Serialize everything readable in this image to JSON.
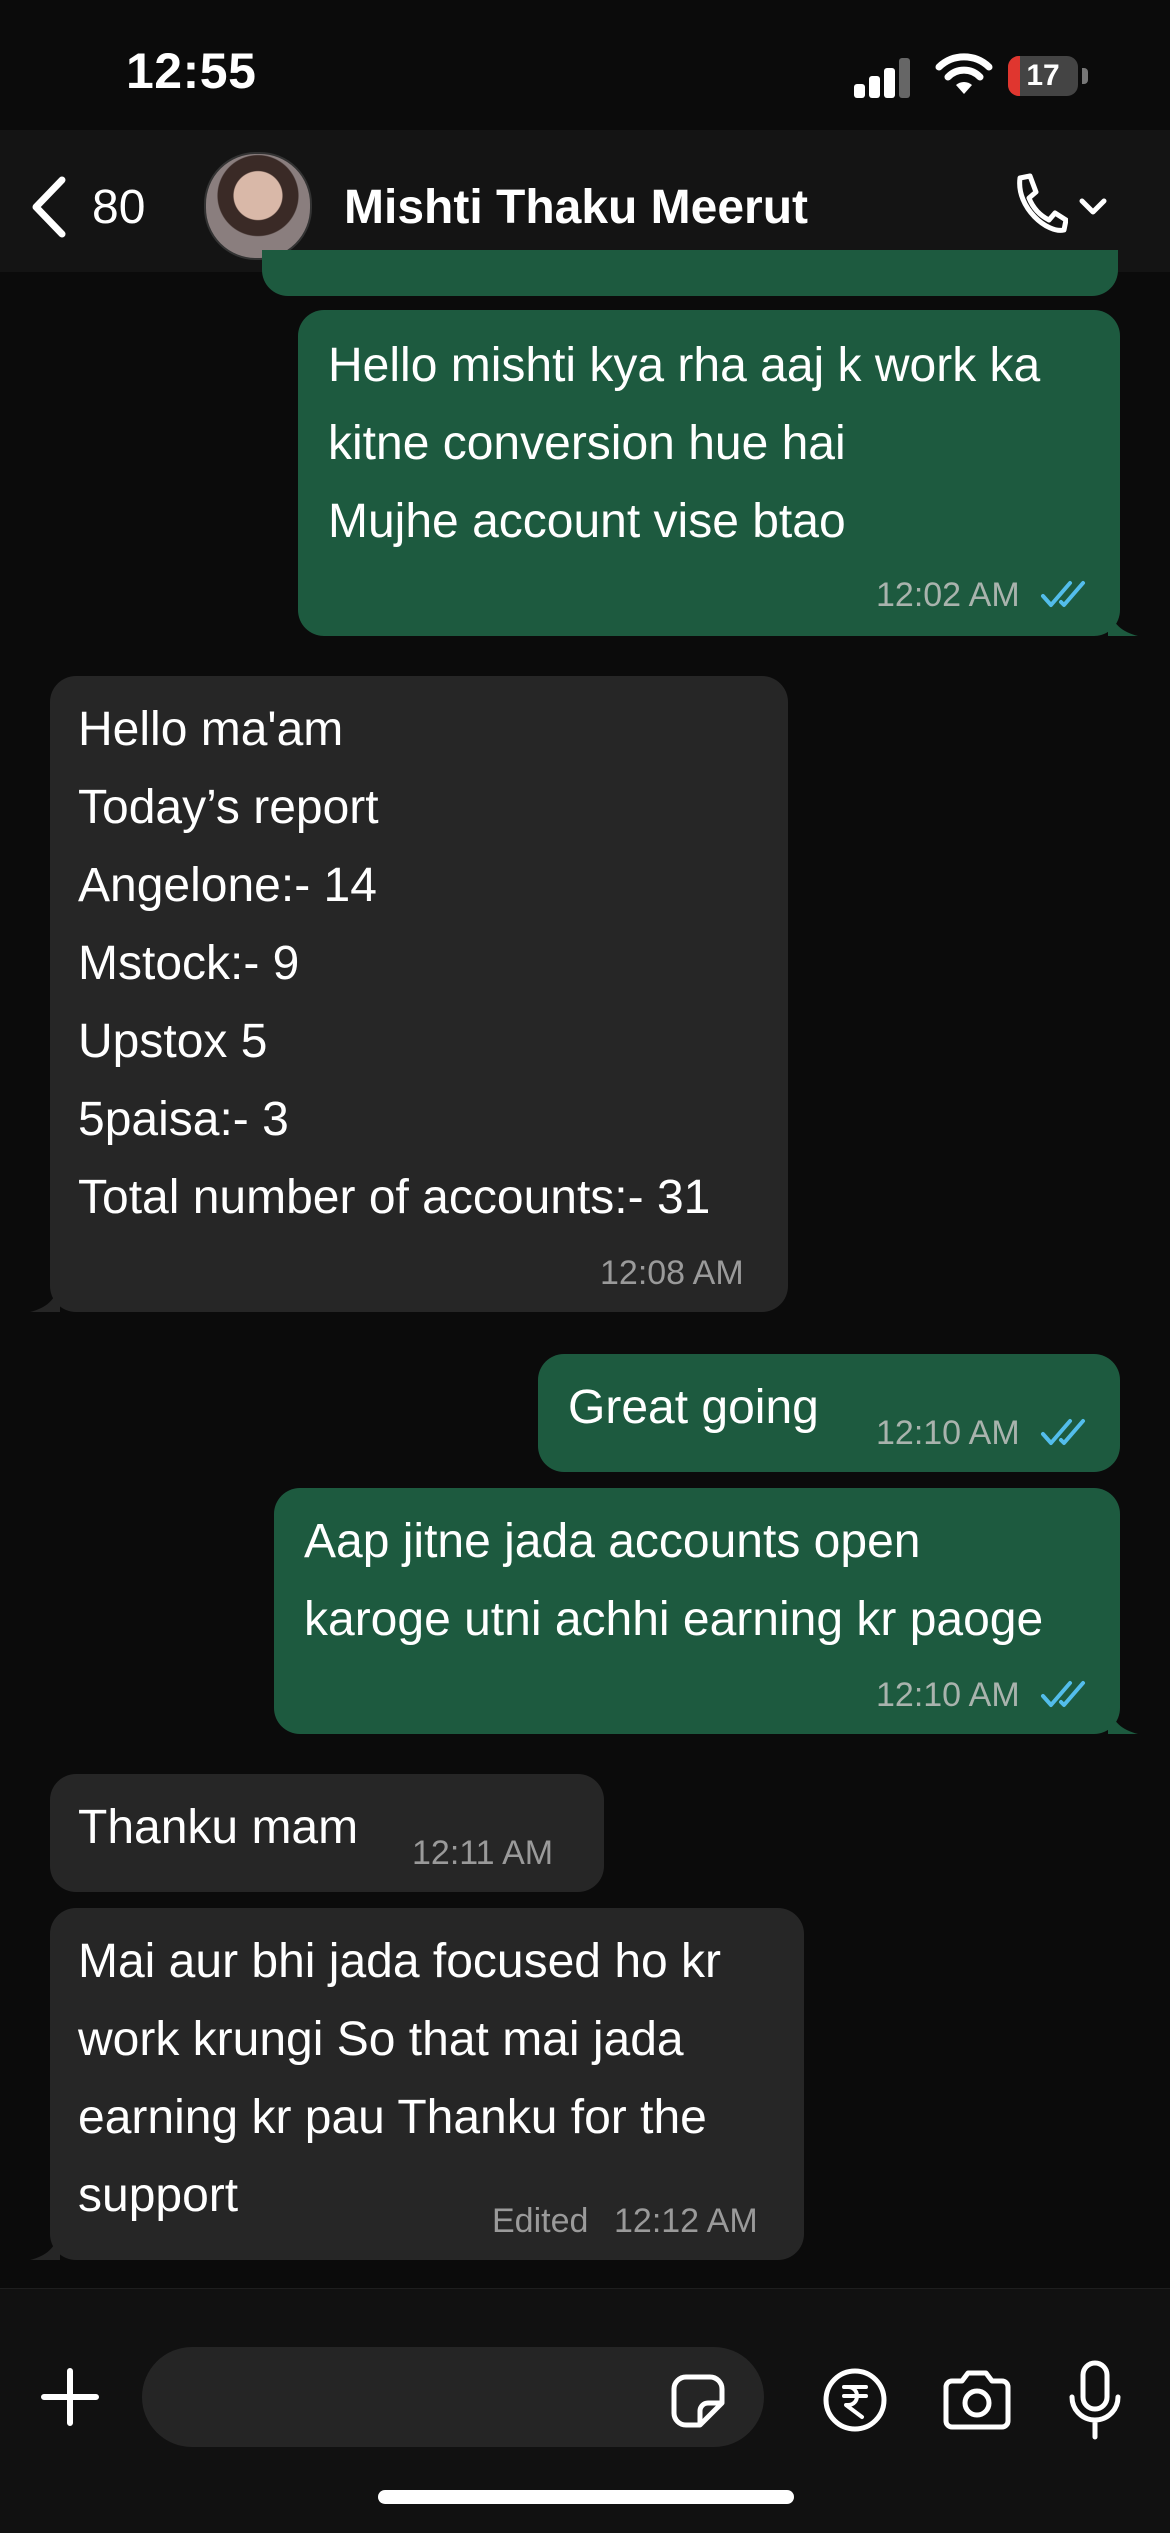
{
  "status_bar": {
    "time": "12:55",
    "battery": "17",
    "battery_level": 0.17
  },
  "header": {
    "back_count": "80",
    "contact_name": "Mishti Thaku Meerut"
  },
  "messages": [
    {
      "lines": [
        "Hello mishti kya rha aaj k work ka",
        "kitne conversion hue hai",
        "Mujhe account vise btao"
      ],
      "time": "12:02 AM"
    },
    {
      "lines": [
        "Hello ma'am",
        "Today’s report",
        "Angelone:- 14",
        "Mstock:- 9",
        "Upstox 5",
        "5paisa:- 3",
        "Total number of accounts:- 31"
      ],
      "time": "12:08 AM"
    },
    {
      "lines": [
        "Great going"
      ],
      "time": "12:10 AM"
    },
    {
      "lines": [
        "Aap jitne jada accounts open",
        "karoge utni achhi earning kr paoge"
      ],
      "time": "12:10 AM"
    },
    {
      "lines": [
        "Thanku mam"
      ],
      "time": "12:11 AM"
    },
    {
      "lines": [
        "Mai aur bhi jada focused ho kr",
        "work krungi So that mai jada",
        "earning kr pau Thanku for the",
        "support"
      ],
      "edited": "Edited",
      "time": "12:12 AM"
    }
  ],
  "colors": {
    "outgoing_bubble": "#1d5a3f",
    "incoming_bubble": "#262626",
    "read_ticks": "#53bdeb",
    "background": "#0b0b0b"
  },
  "icons": [
    "back-chevron-icon",
    "phone-icon",
    "chevron-down-icon",
    "plus-icon",
    "sticker-icon",
    "rupee-icon",
    "camera-icon",
    "microphone-icon"
  ]
}
